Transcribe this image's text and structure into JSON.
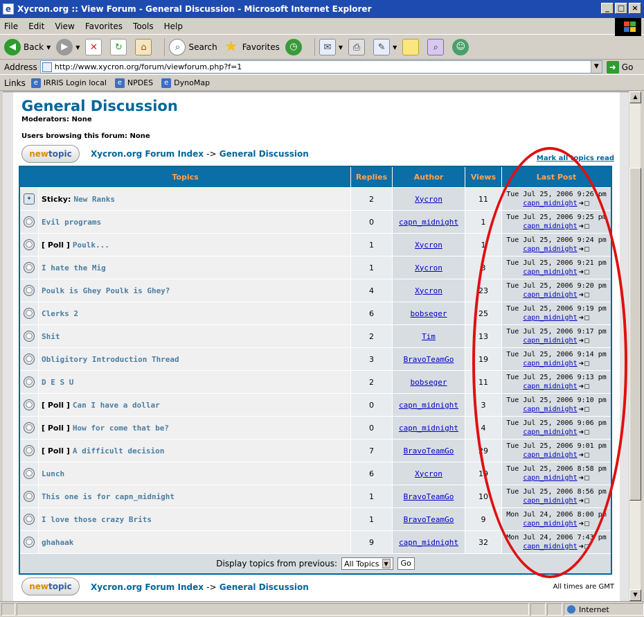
{
  "window": {
    "title": "Xycron.org :: View Forum - General Discussion - Microsoft Internet Explorer"
  },
  "menu": [
    "File",
    "Edit",
    "View",
    "Favorites",
    "Tools",
    "Help"
  ],
  "toolbar": {
    "back": "Back",
    "search": "Search",
    "favorites": "Favorites"
  },
  "address": {
    "label": "Address",
    "url": "http://www.xycron.org/forum/viewforum.php?f=1",
    "go": "Go"
  },
  "links": {
    "label": "Links",
    "items": [
      "IRRIS Login local",
      "NPDES",
      "DynoMap"
    ]
  },
  "forum": {
    "title": "General Discussion",
    "moderators": "Moderators: None",
    "browsing": "Users browsing this forum: None",
    "newtopic_new": "new",
    "newtopic_topic": "topic",
    "crumb_index": "Xycron.org Forum Index",
    "crumb_sep": "->",
    "crumb_current": "General Discussion",
    "mark_all": "Mark all topics read",
    "headers": {
      "topics": "Topics",
      "replies": "Replies",
      "author": "Author",
      "views": "Views",
      "last_post": "Last Post"
    },
    "topics": [
      {
        "prefix": "Sticky:",
        "title": "New Ranks",
        "replies": "2",
        "author": "Xycron",
        "views": "11",
        "last_date": "Tue Jul 25, 2006 9:26 pm",
        "last_user": "capn_midnight"
      },
      {
        "prefix": "",
        "title": "Evil programs",
        "replies": "0",
        "author": "capn_midnight",
        "views": "1",
        "last_date": "Tue Jul 25, 2006 9:25 pm",
        "last_user": "capn_midnight"
      },
      {
        "prefix": "[ Poll ]",
        "title": "Poulk...",
        "replies": "1",
        "author": "Xycron",
        "views": "1",
        "last_date": "Tue Jul 25, 2006 9:24 pm",
        "last_user": "capn_midnight"
      },
      {
        "prefix": "",
        "title": "I hate the Mig",
        "replies": "1",
        "author": "Xycron",
        "views": "3",
        "last_date": "Tue Jul 25, 2006 9:21 pm",
        "last_user": "capn_midnight"
      },
      {
        "prefix": "",
        "title": "Poulk is Ghey Poulk is Ghey?",
        "replies": "4",
        "author": "Xycron",
        "views": "23",
        "last_date": "Tue Jul 25, 2006 9:20 pm",
        "last_user": "capn_midnight"
      },
      {
        "prefix": "",
        "title": "Clerks 2",
        "replies": "6",
        "author": "bobseger",
        "views": "25",
        "last_date": "Tue Jul 25, 2006 9:19 pm",
        "last_user": "capn_midnight"
      },
      {
        "prefix": "",
        "title": "Shit",
        "replies": "2",
        "author": "Tim",
        "views": "13",
        "last_date": "Tue Jul 25, 2006 9:17 pm",
        "last_user": "capn_midnight"
      },
      {
        "prefix": "",
        "title": "Obligitory Introduction Thread",
        "replies": "3",
        "author": "BravoTeamGo",
        "views": "19",
        "last_date": "Tue Jul 25, 2006 9:14 pm",
        "last_user": "capn_midnight"
      },
      {
        "prefix": "",
        "title": "D E S U",
        "replies": "2",
        "author": "bobseger",
        "views": "11",
        "last_date": "Tue Jul 25, 2006 9:13 pm",
        "last_user": "capn_midnight"
      },
      {
        "prefix": "[ Poll ]",
        "title": "Can I have a dollar",
        "replies": "0",
        "author": "capn_midnight",
        "views": "3",
        "last_date": "Tue Jul 25, 2006 9:10 pm",
        "last_user": "capn_midnight"
      },
      {
        "prefix": "[ Poll ]",
        "title": "How for come that be?",
        "replies": "0",
        "author": "capn_midnight",
        "views": "4",
        "last_date": "Tue Jul 25, 2006 9:06 pm",
        "last_user": "capn_midnight"
      },
      {
        "prefix": "[ Poll ]",
        "title": "A difficult decision",
        "replies": "7",
        "author": "BravoTeamGo",
        "views": "29",
        "last_date": "Tue Jul 25, 2006 9:01 pm",
        "last_user": "capn_midnight"
      },
      {
        "prefix": "",
        "title": "Lunch",
        "replies": "6",
        "author": "Xycron",
        "views": "19",
        "last_date": "Tue Jul 25, 2006 8:58 pm",
        "last_user": "capn_midnight"
      },
      {
        "prefix": "",
        "title": "This one is for capn_midnight",
        "replies": "1",
        "author": "BravoTeamGo",
        "views": "10",
        "last_date": "Tue Jul 25, 2006 8:56 pm",
        "last_user": "capn_midnight"
      },
      {
        "prefix": "",
        "title": "I love those crazy Brits",
        "replies": "1",
        "author": "BravoTeamGo",
        "views": "9",
        "last_date": "Mon Jul 24, 2006 8:00 pm",
        "last_user": "capn_midnight"
      },
      {
        "prefix": "",
        "title": "ghahaak",
        "replies": "9",
        "author": "capn_midnight",
        "views": "32",
        "last_date": "Mon Jul 24, 2006 7:43 pm",
        "last_user": "capn_midnight"
      }
    ],
    "display_label": "Display topics from previous:",
    "display_value": "All Topics",
    "display_go": "Go",
    "times_note": "All times are GMT"
  },
  "status": {
    "zone": "Internet"
  }
}
